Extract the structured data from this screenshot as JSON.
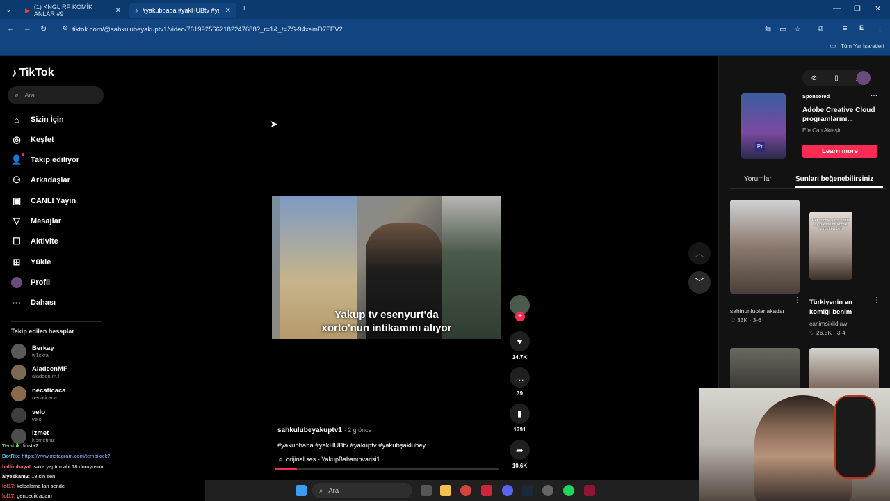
{
  "browser": {
    "tabs": [
      {
        "label": "(1) KNGL RP KOMİK ANLAR #9",
        "active": false
      },
      {
        "label": "#yakubbaba #yakHUBtv #yakupt",
        "active": true
      }
    ],
    "url": "tiktok.com/@sahkulubeyakuptv1/video/7619925662182247688?_r=1&_t=ZS-94xemD7FEV2",
    "bookmarks_label": "Tüm Yer İşaretleri",
    "profile_letter": "E"
  },
  "sidebar": {
    "logo": "TikTok",
    "search_placeholder": "Ara",
    "nav": [
      {
        "label": "Sizin İçin",
        "icon": "home-icon"
      },
      {
        "label": "Keşfet",
        "icon": "compass-icon"
      },
      {
        "label": "Takip ediliyor",
        "icon": "following-icon"
      },
      {
        "label": "Arkadaşlar",
        "icon": "friends-icon"
      },
      {
        "label": "CANLI Yayın",
        "icon": "live-icon"
      },
      {
        "label": "Mesajlar",
        "icon": "messages-icon"
      },
      {
        "label": "Aktivite",
        "icon": "activity-icon"
      },
      {
        "label": "Yükle",
        "icon": "upload-icon"
      },
      {
        "label": "Profil",
        "icon": "profile-icon"
      },
      {
        "label": "Dahası",
        "icon": "more-icon"
      }
    ],
    "following_title": "Takip edilen hesaplar",
    "following": [
      {
        "name": "Berkay",
        "handle": "w1ckra"
      },
      {
        "name": "AladeenMF",
        "handle": "aladeen.m.f"
      },
      {
        "name": "necaticaca",
        "handle": "necaticaca"
      },
      {
        "name": "velo",
        "handle": "velo"
      },
      {
        "name": "izmet",
        "handle": "kismetiniz"
      }
    ]
  },
  "chat": [
    {
      "user": "Tembik",
      "text": ": !insta2",
      "color": "#7ad46a"
    },
    {
      "user": "BotRix",
      "text": ": https://www.instagram.com/tembikick?",
      "color": "#4ec9ff"
    },
    {
      "user": "ballimhayat",
      "text": ": saka yaptım abi 18 duruyosun",
      "color": "#ff6f6f"
    },
    {
      "user": "alyeskam2",
      "text": ": 18 sin sen",
      "color": "#f0f0f0"
    },
    {
      "user": "lol17",
      "text": ": kolpalama lan sende",
      "color": "#ff4d4d"
    },
    {
      "user": "lol17",
      "text": ": gencecik adam",
      "color": "#ff4d4d"
    }
  ],
  "video": {
    "subtitle_line1": "Yakup tv esenyurt'da",
    "subtitle_line2": "xorto'nun intikamını alıyor",
    "author": "sahkulubeyakuptv1",
    "time": "· 2 g önce",
    "hashtags": "#yakubbaba #yakHUBtv #yakuptv #yakubşaklubey",
    "sound": "orijinal ses - YakupBabanınvarisi1",
    "progress": 0.1
  },
  "actions": {
    "likes": "14.7K",
    "comments": "39",
    "saves": "1791",
    "shares": "10.6K"
  },
  "right": {
    "sponsored_label": "Sponsored",
    "ad_title": "Adobe Creative Cloud programlarını...",
    "ad_author": "Efe Can Aktaşlı",
    "ad_button": "Learn more",
    "tab_comments": "Yorumlar",
    "tab_suggested": "Şunları beğenebilirsiniz",
    "videos": [
      {
        "title": "",
        "author": "sahinunluolanakadar",
        "stats": "33K · 3-6",
        "thumb_text": ""
      },
      {
        "title": "Türkiyenin en komiği benim",
        "author": "canimsikildiaw",
        "stats": "26.5K · 3-4",
        "thumb_text": "Her saniye şaka spam ayıp kendimi komik sanarken ben"
      }
    ]
  },
  "taskbar": {
    "search_label": "Ara"
  },
  "colors": {
    "accent": "#fe2c55",
    "chrome_bg": "#12457f",
    "tab_bg": "#0b3a6f"
  }
}
